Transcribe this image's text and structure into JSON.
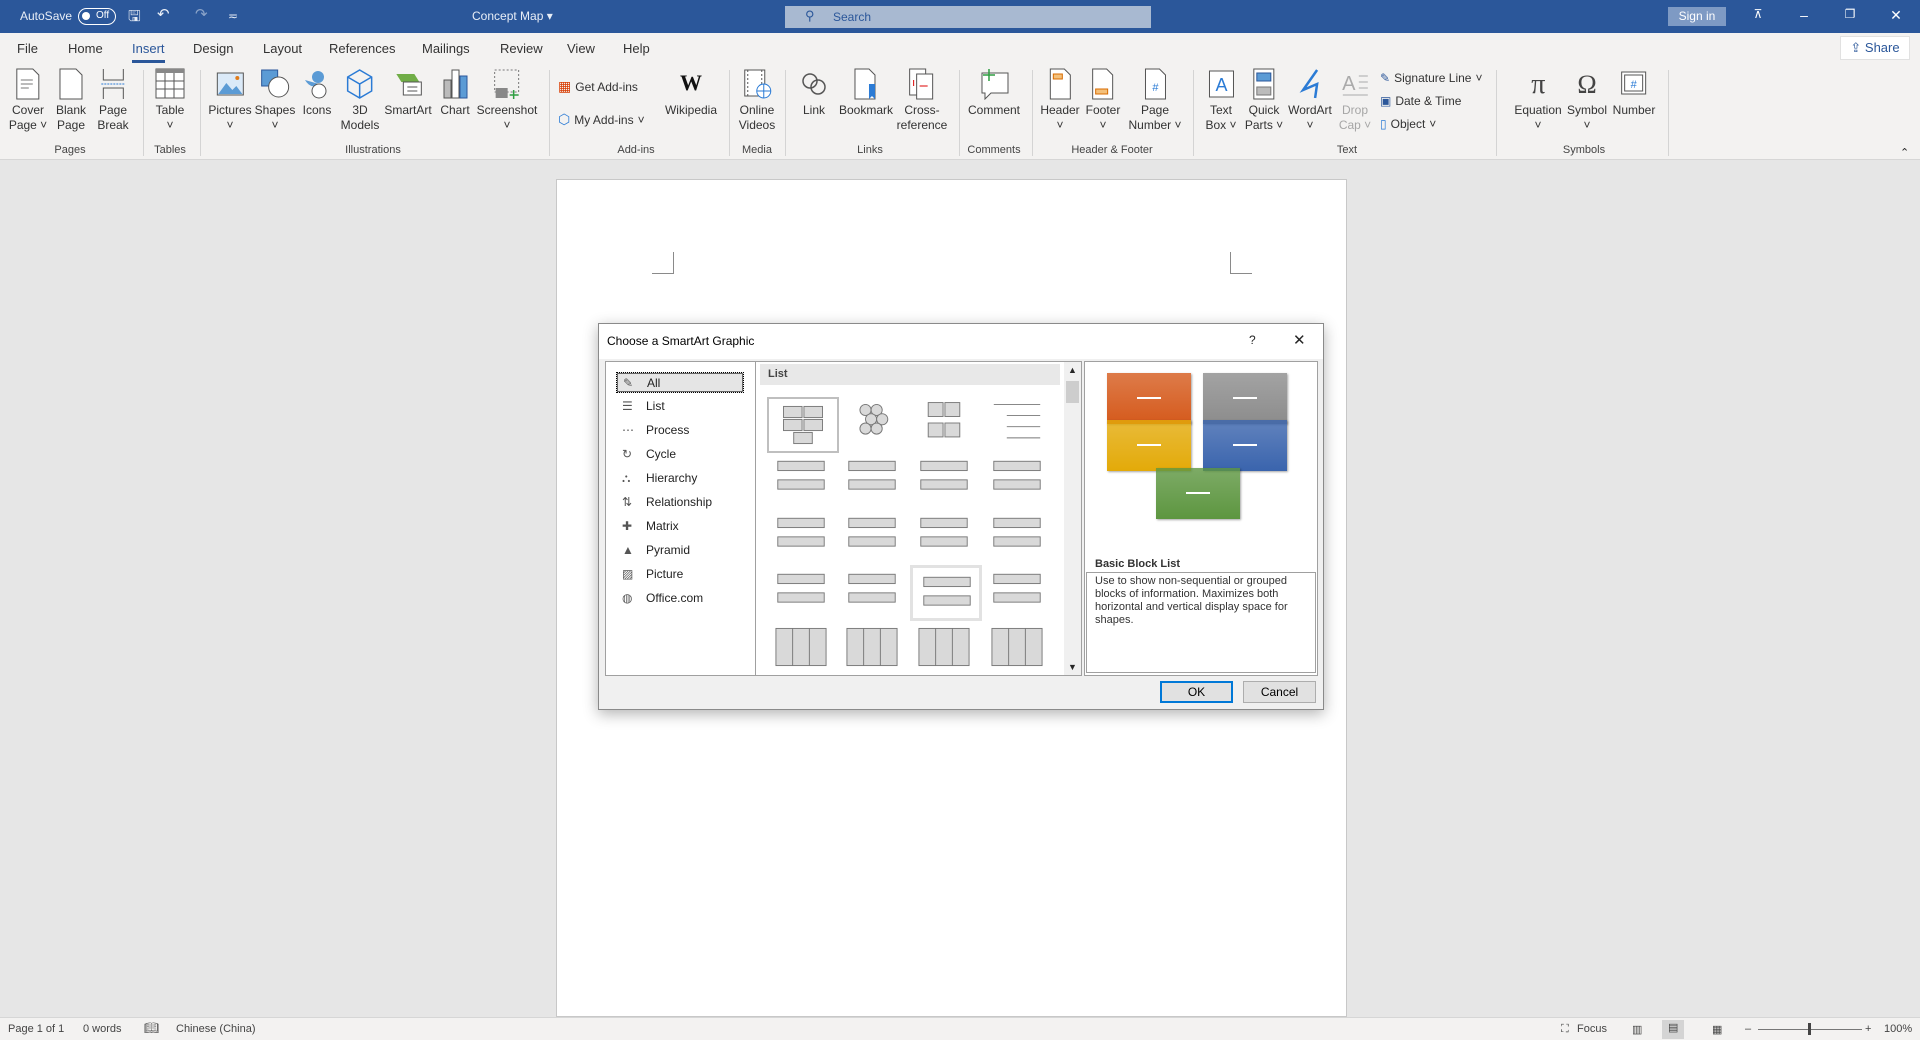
{
  "titlebar": {
    "autosave_label": "AutoSave",
    "autosave_state": "Off",
    "doc_title": "Concept Map ▾",
    "search_placeholder": "Search",
    "signin": "Sign in",
    "share": "Share"
  },
  "tabs": [
    "File",
    "Home",
    "Insert",
    "Design",
    "Layout",
    "References",
    "Mailings",
    "Review",
    "View",
    "Help"
  ],
  "active_tab": "Insert",
  "ribbon": {
    "buttons": {
      "cover": "Cover",
      "cover2": "Page ˅",
      "blank": "Blank",
      "blank2": "Page",
      "pbreak": "Page",
      "pbreak2": "Break",
      "table": "Table",
      "pictures": "Pictures",
      "shapes": "Shapes",
      "icons": "Icons",
      "models": "3D",
      "models2": "Models",
      "smartart": "SmartArt",
      "chart": "Chart",
      "screenshot": "Screenshot",
      "getaddins": "Get Add-ins",
      "myaddins": "My Add-ins",
      "wikipedia": "Wikipedia",
      "videos": "Online",
      "videos2": "Videos",
      "link": "Link",
      "bookmark": "Bookmark",
      "xref": "Cross-",
      "xref2": "reference",
      "comment": "Comment",
      "header": "Header",
      "footer": "Footer",
      "pagenum": "Page",
      "pagenum2": "Number ˅",
      "textbox": "Text",
      "textbox2": "Box ˅",
      "quickparts": "Quick",
      "quickparts2": "Parts ˅",
      "wordart": "WordArt",
      "dropcap": "Drop",
      "dropcap2": "Cap ˅",
      "sigline": "Signature Line",
      "datetime": "Date & Time",
      "object": "Object",
      "equation": "Equation",
      "symbol": "Symbol",
      "number": "Number"
    },
    "groups": [
      "Pages",
      "Tables",
      "Illustrations",
      "Add-ins",
      "Media",
      "Links",
      "Comments",
      "Header & Footer",
      "Text",
      "Symbols"
    ]
  },
  "status": {
    "page": "Page 1 of 1",
    "words": "0 words",
    "language": "Chinese (China)",
    "focus": "Focus",
    "zoom": "100%",
    "zoom_level_percent": 100
  },
  "dialog": {
    "title": "Choose a SmartArt Graphic",
    "help": "?",
    "close": "✕",
    "categories": [
      "All",
      "List",
      "Process",
      "Cycle",
      "Hierarchy",
      "Relationship",
      "Matrix",
      "Pyramid",
      "Picture",
      "Office.com"
    ],
    "selected_category": "All",
    "gallery_header": "List",
    "preview": {
      "name": "Basic Block List",
      "description": "Use to show non-sequential or grouped blocks of information. Maximizes both horizontal and vertical display space for shapes.",
      "colors": [
        "#d55a1c",
        "#8c8c8c",
        "#e3aa09",
        "#3a64ad",
        "#5d9640"
      ]
    },
    "ok": "OK",
    "cancel": "Cancel"
  },
  "colors": {
    "accent": "#2b579a"
  }
}
